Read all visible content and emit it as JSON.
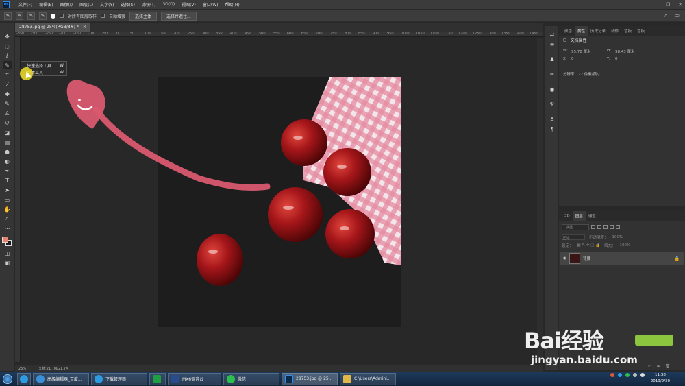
{
  "app": {
    "logo": "Ps"
  },
  "menu": [
    "文件(F)",
    "编辑(E)",
    "图像(I)",
    "图层(L)",
    "文字(Y)",
    "选择(S)",
    "滤镜(T)",
    "3D(D)",
    "视图(V)",
    "窗口(W)",
    "帮助(H)"
  ],
  "window_controls": [
    "minimize",
    "restore",
    "close"
  ],
  "options": {
    "sample_all_layers": "对所有图层取样",
    "auto_enhance": "自动增强",
    "select_subject": "选择主体",
    "select_and_mask": "选择并遮住..."
  },
  "document": {
    "tab_title": "28753.jpg @ 25%(RGB/8#) *",
    "tab_close": "×"
  },
  "ruler_ticks": [
    "-350",
    "-300",
    "-250",
    "-200",
    "-150",
    "-100",
    "-50",
    "0",
    "50",
    "100",
    "150",
    "200",
    "250",
    "300",
    "350",
    "400",
    "450",
    "500",
    "550",
    "600",
    "650",
    "700",
    "750",
    "800",
    "850",
    "900",
    "950",
    "1000",
    "1050",
    "1100",
    "1150",
    "1200",
    "1250",
    "1300",
    "1350",
    "1400",
    "1450"
  ],
  "flyout": {
    "items": [
      {
        "label": "快速选择工具",
        "shortcut": "W"
      },
      {
        "label": "魔棒工具",
        "shortcut": "W"
      }
    ]
  },
  "status": {
    "zoom": "25%",
    "doc_size": "文档:21.7M/21.7M"
  },
  "properties": {
    "tabs": [
      "颜色",
      "属性",
      "历史记录",
      "动作",
      "色板",
      "色板"
    ],
    "active_tab": "属性",
    "title": "文档属性",
    "w_label": "W:",
    "w_value": "95.78 厘米",
    "h_label": "H:",
    "h_value": "98.43 厘米",
    "x_label": "X:",
    "x_value": "0",
    "y_label": "Y:",
    "y_value": "0",
    "resolution": "分辨率：72 像素/英寸"
  },
  "layers": {
    "tabs": [
      "3D",
      "图层",
      "通道"
    ],
    "active_tab": "图层",
    "search_placeholder": "类型",
    "blend_mode": "正常",
    "opacity_label": "不透明度：",
    "opacity_value": "100%",
    "lock_label": "锁定：",
    "fill_label": "填充：",
    "fill_value": "100%",
    "layer_name": "背景"
  },
  "watermark": {
    "brand": "Bai经验",
    "url": "jingyan.baidu.com"
  },
  "taskbar": {
    "items": [
      {
        "label": "高级编辑器_百度...",
        "color": "#3a8fd8"
      },
      {
        "label": "下载管理器",
        "color": "#2e9be0"
      },
      {
        "label": "",
        "color": "#1f9e43"
      },
      {
        "label": "MX6调音台",
        "color": "#2a4b8c"
      },
      {
        "label": "微信",
        "color": "#2dbf4d"
      },
      {
        "label": "28753.jpg @ 25...",
        "color": "#0b2a4a"
      },
      {
        "label": "C:\\Users\\Admini...",
        "color": "#e0b84a"
      }
    ],
    "time": "11:38",
    "date": "2019/9/30"
  }
}
